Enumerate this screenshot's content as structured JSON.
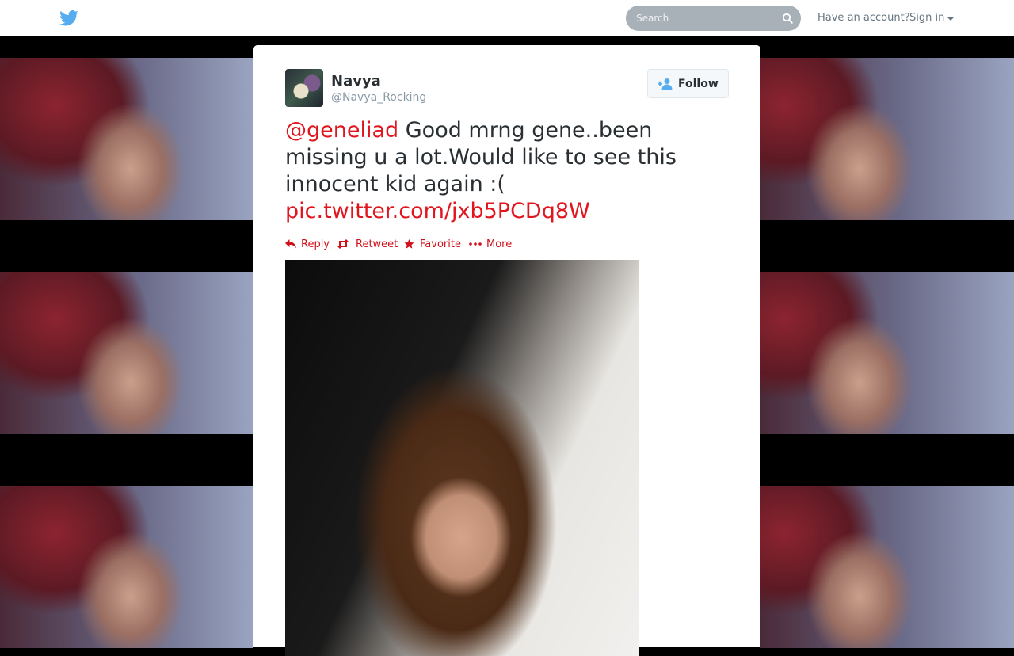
{
  "topbar": {
    "search_placeholder": "Search",
    "account_text": "Have an account?",
    "signin_label": "Sign in"
  },
  "tweet": {
    "author_name": "Navya",
    "author_handle": "@Navya_Rocking",
    "follow_label": "Follow",
    "mention": "@geneliad",
    "text": " Good mrng gene..been missing u a lot.Would like to see this innocent kid again :( ",
    "link": "pic.twitter.com/jxb5PCDq8W"
  },
  "actions": {
    "reply": "Reply",
    "retweet": "Retweet",
    "favorite": "Favorite",
    "more": "More"
  },
  "colors": {
    "link": "#e0151e",
    "action": "#d0111b",
    "bird": "#55acee"
  }
}
